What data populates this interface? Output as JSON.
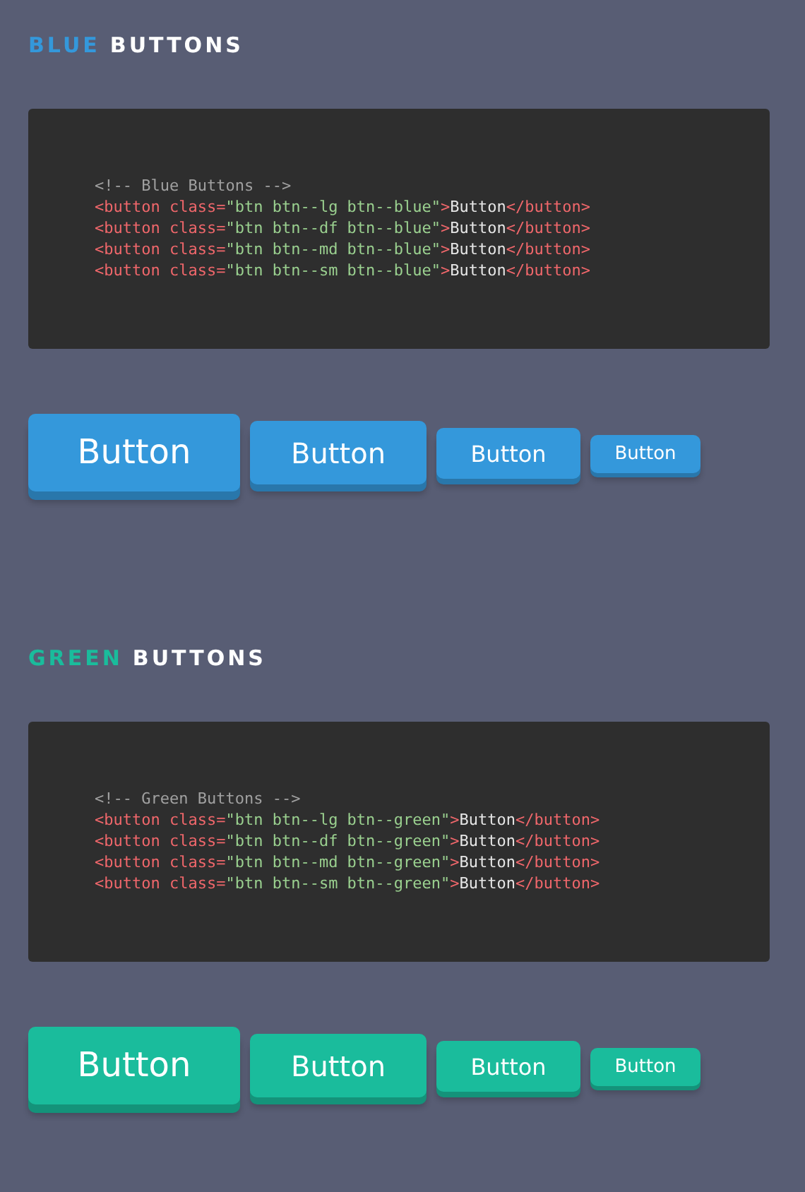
{
  "sections": [
    {
      "title": {
        "accent": "BLUE",
        "rest": "BUTTONS"
      },
      "color": "#3498db",
      "code": [
        [
          {
            "kind": "comment",
            "text": "<!-- Blue Buttons -->"
          }
        ],
        [
          {
            "kind": "tag",
            "text": "<button class="
          },
          {
            "kind": "string",
            "text": "\"btn btn--lg btn--blue\""
          },
          {
            "kind": "tag",
            "text": ">"
          },
          {
            "kind": "text",
            "text": "Button"
          },
          {
            "kind": "tag",
            "text": "</button>"
          }
        ],
        [
          {
            "kind": "tag",
            "text": "<button class="
          },
          {
            "kind": "string",
            "text": "\"btn btn--df btn--blue\""
          },
          {
            "kind": "tag",
            "text": ">"
          },
          {
            "kind": "text",
            "text": "Button"
          },
          {
            "kind": "tag",
            "text": "</button>"
          }
        ],
        [
          {
            "kind": "tag",
            "text": "<button class="
          },
          {
            "kind": "string",
            "text": "\"btn btn--md btn--blue\""
          },
          {
            "kind": "tag",
            "text": ">"
          },
          {
            "kind": "text",
            "text": "Button"
          },
          {
            "kind": "tag",
            "text": "</button>"
          }
        ],
        [
          {
            "kind": "tag",
            "text": "<button class="
          },
          {
            "kind": "string",
            "text": "\"btn btn--sm btn--blue\""
          },
          {
            "kind": "tag",
            "text": ">"
          },
          {
            "kind": "text",
            "text": "Button"
          },
          {
            "kind": "tag",
            "text": "</button>"
          }
        ]
      ],
      "buttons": [
        {
          "kind": "lg",
          "label": "Button"
        },
        {
          "kind": "df",
          "label": "Button"
        },
        {
          "kind": "md",
          "label": "Button"
        },
        {
          "kind": "sm",
          "label": "Button"
        }
      ]
    },
    {
      "title": {
        "accent": "GREEN",
        "rest": "BUTTONS"
      },
      "color": "#1abc9c",
      "code": [
        [
          {
            "kind": "comment",
            "text": "<!-- Green Buttons -->"
          }
        ],
        [
          {
            "kind": "tag",
            "text": "<button class="
          },
          {
            "kind": "string",
            "text": "\"btn btn--lg btn--green\""
          },
          {
            "kind": "tag",
            "text": ">"
          },
          {
            "kind": "text",
            "text": "Button"
          },
          {
            "kind": "tag",
            "text": "</button>"
          }
        ],
        [
          {
            "kind": "tag",
            "text": "<button class="
          },
          {
            "kind": "string",
            "text": "\"btn btn--df btn--green\""
          },
          {
            "kind": "tag",
            "text": ">"
          },
          {
            "kind": "text",
            "text": "Button"
          },
          {
            "kind": "tag",
            "text": "</button>"
          }
        ],
        [
          {
            "kind": "tag",
            "text": "<button class="
          },
          {
            "kind": "string",
            "text": "\"btn btn--md btn--green\""
          },
          {
            "kind": "tag",
            "text": ">"
          },
          {
            "kind": "text",
            "text": "Button"
          },
          {
            "kind": "tag",
            "text": "</button>"
          }
        ],
        [
          {
            "kind": "tag",
            "text": "<button class="
          },
          {
            "kind": "string",
            "text": "\"btn btn--sm btn--green\""
          },
          {
            "kind": "tag",
            "text": ">"
          },
          {
            "kind": "text",
            "text": "Button"
          },
          {
            "kind": "tag",
            "text": "</button>"
          }
        ]
      ],
      "buttons": [
        {
          "kind": "lg",
          "label": "Button"
        },
        {
          "kind": "df",
          "label": "Button"
        },
        {
          "kind": "md",
          "label": "Button"
        },
        {
          "kind": "sm",
          "label": "Button"
        }
      ]
    }
  ]
}
